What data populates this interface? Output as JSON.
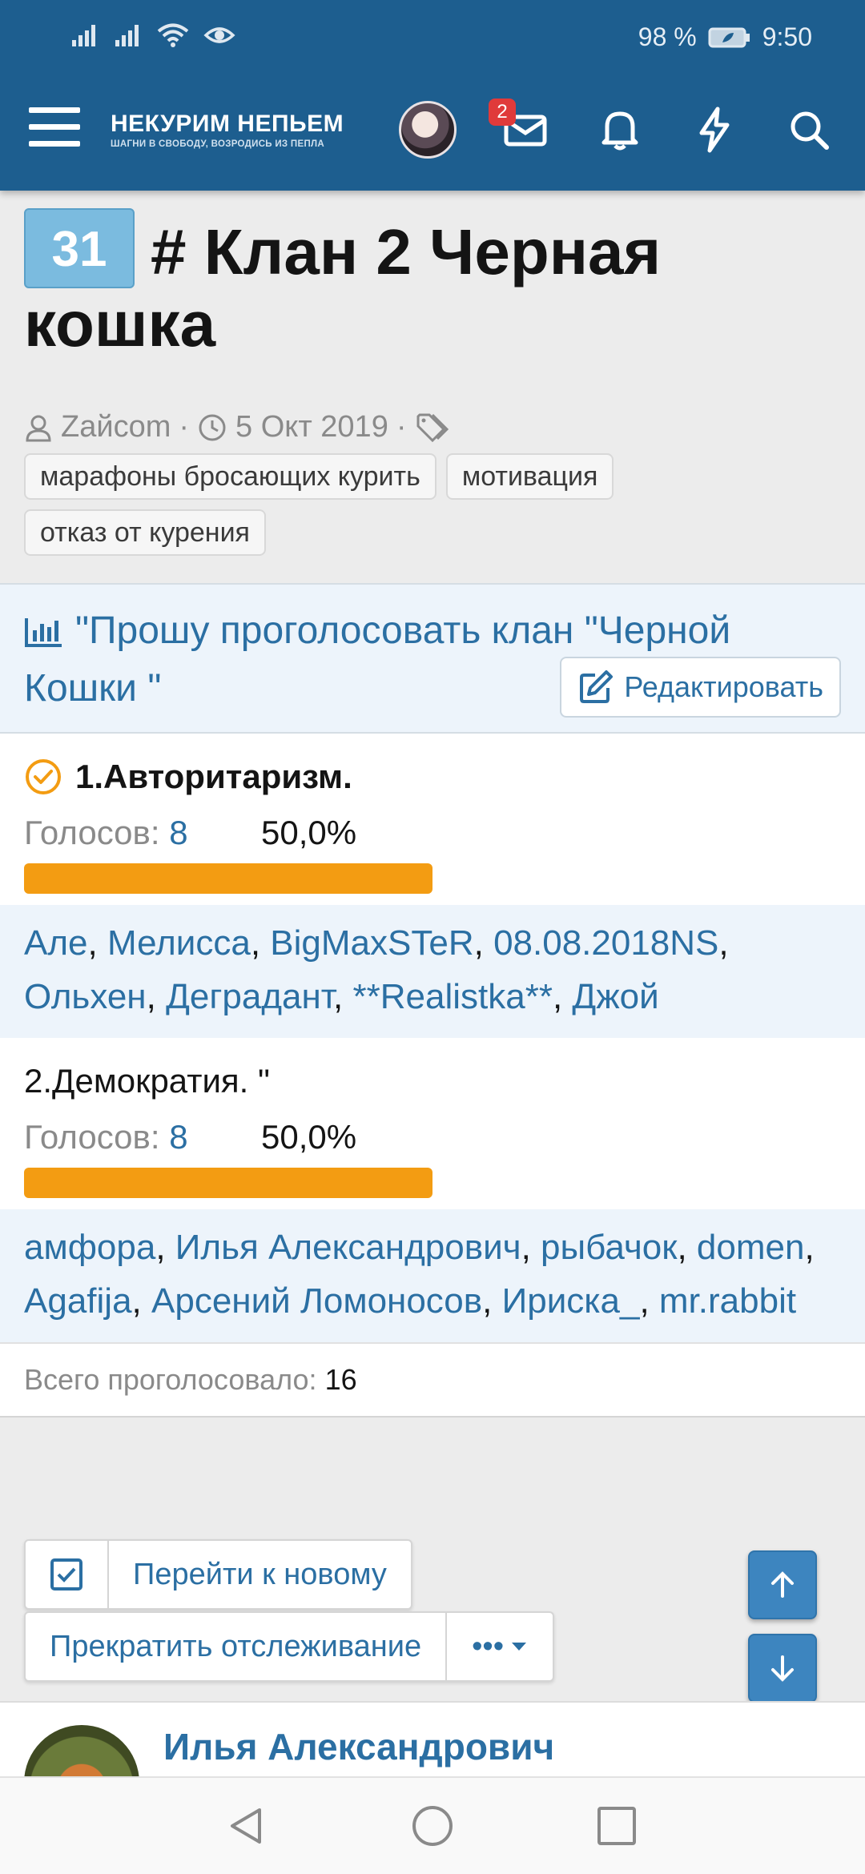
{
  "status_bar": {
    "battery": "98 %",
    "time": "9:50"
  },
  "header": {
    "logo_title": "НЕКУРИМ НЕПЬЕМ",
    "logo_tagline": "ШАГНИ В СВОБОДУ, ВОЗРОДИСЬ ИЗ ПЕПЛА",
    "messages_badge": "2",
    "icons": [
      "menu-icon",
      "avatar",
      "envelope-icon",
      "bell-icon",
      "lightning-icon",
      "search-icon"
    ]
  },
  "thread": {
    "reply_count": "31",
    "title": "# Клан 2 Черная кошка",
    "author": "Zaйcom",
    "date": "5 Окт 2019",
    "tags": [
      "марафоны бросающих курить",
      "мотивация",
      "отказ от курения"
    ]
  },
  "poll": {
    "question": "\"Прошу проголосовать клан \"Черной Кошки \"",
    "edit_label": "Редактировать",
    "votes_label": "Голосов:",
    "options": [
      {
        "label": "1.Авторитаризм.",
        "votes": "8",
        "percent": "50,0%",
        "share": 0.5,
        "voted_by_me": true,
        "voters": [
          "Але",
          "Мелисса",
          "BigMaxSTeR",
          "08.08.2018NS",
          "Ольхен",
          "Деградант",
          "**Realistka**",
          "Джой"
        ]
      },
      {
        "label": "2.Демократия. \"",
        "votes": "8",
        "percent": "50,0%",
        "share": 0.5,
        "voted_by_me": false,
        "voters": [
          "амфора",
          "Илья Александрович",
          "рыбачок",
          "domen",
          "Agafija",
          "Арсений Ломоносов",
          "Ириска_",
          "mr.rabbit"
        ]
      }
    ],
    "total_label": "Всего проголосовало:",
    "total": "16"
  },
  "actions": {
    "go_new": "Перейти к новому",
    "unwatch": "Прекратить отслеживание",
    "more": "•••"
  },
  "post": {
    "author": "Илья Александрович"
  },
  "colors": {
    "header_bg": "#1d5e8f",
    "link": "#2b6fa3",
    "bar": "#f39c12",
    "badge": "#e03a3a",
    "count_badge": "#7bbbdf"
  }
}
